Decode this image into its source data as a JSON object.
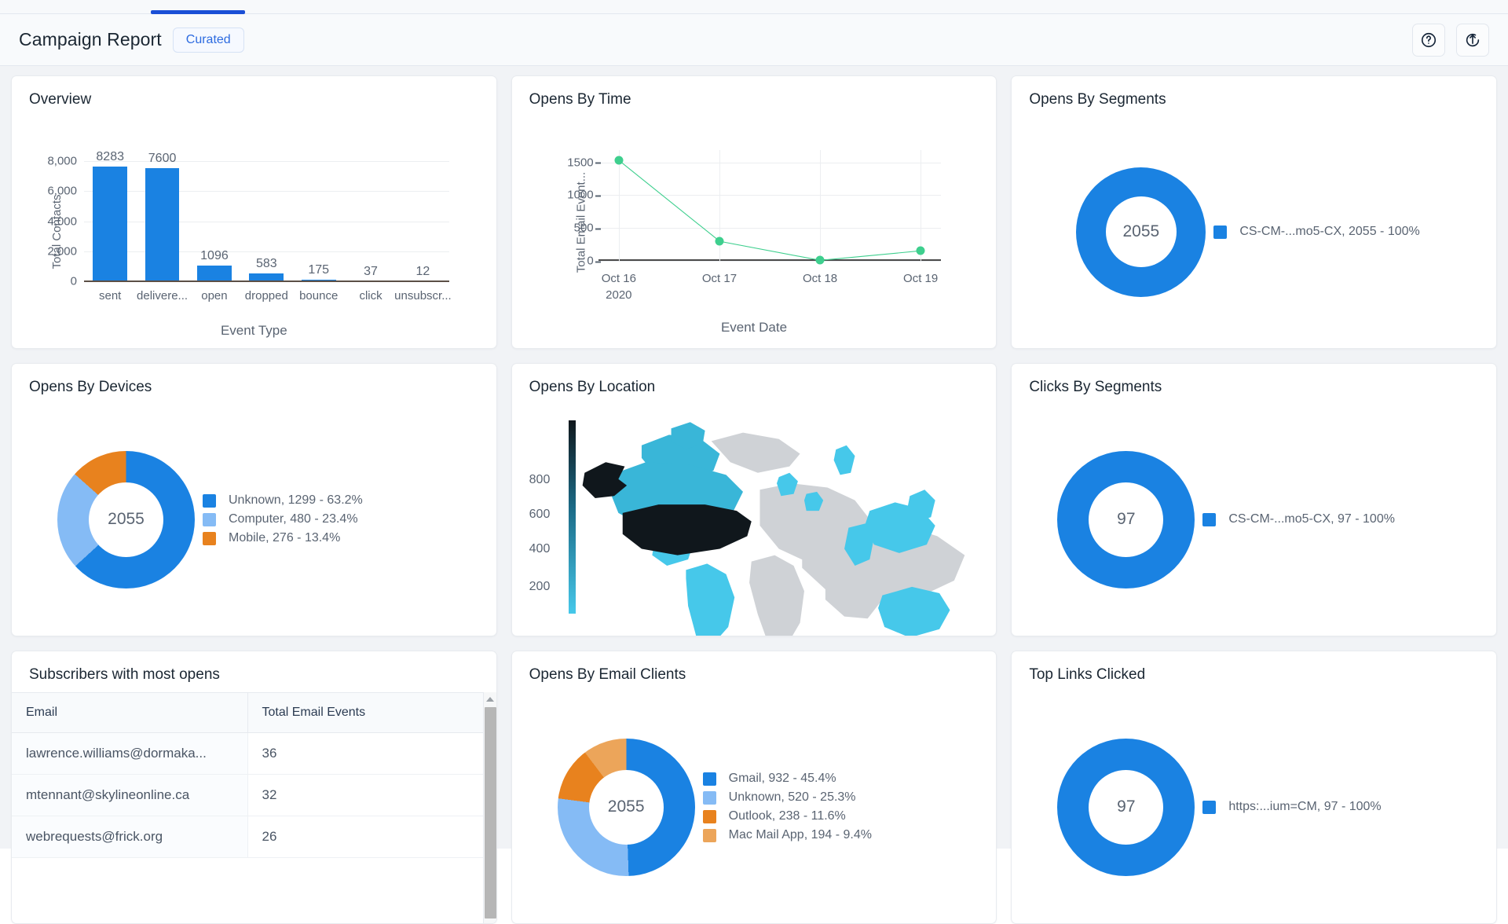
{
  "header": {
    "title": "Campaign Report",
    "badge": "Curated",
    "help_icon": "help-circle-icon",
    "export_icon": "export-up-icon"
  },
  "cards": {
    "overview": {
      "title": "Overview"
    },
    "opens_by_time": {
      "title": "Opens By Time"
    },
    "opens_by_segments": {
      "title": "Opens By Segments"
    },
    "opens_by_devices": {
      "title": "Opens By Devices"
    },
    "opens_by_location": {
      "title": "Opens By Location"
    },
    "clicks_by_segments": {
      "title": "Clicks By Segments"
    },
    "subscribers": {
      "title": "Subscribers with most opens"
    },
    "opens_by_email_clients": {
      "title": "Opens By Email Clients"
    },
    "top_links": {
      "title": "Top Links Clicked"
    }
  },
  "table": {
    "columns": [
      "Email",
      "Total Email Events"
    ],
    "rows": [
      [
        "lawrence.williams@dormaka...",
        "36"
      ],
      [
        "mtennant@skylineonline.ca",
        "32"
      ],
      [
        "webrequests@frick.org",
        "26"
      ]
    ]
  },
  "colors": {
    "blue": "#1a82e2",
    "light_blue": "#85bbf5",
    "orange": "#e8821e",
    "light_orange": "#eca55a",
    "green": "#3ecf8e",
    "map_dark": "#10171c",
    "map_mid": "#39b6d8",
    "map_light": "#46c8ea",
    "map_none": "#cfd2d6",
    "accent": "#1a4fd6"
  },
  "chart_data": [
    {
      "type": "bar",
      "title": "Overview",
      "xlabel": "Event Type",
      "ylabel": "Total Contacts",
      "categories": [
        "sent",
        "delivere...",
        "open",
        "dropped",
        "bounce",
        "click",
        "unsubscr..."
      ],
      "values": [
        8283,
        7600,
        1096,
        583,
        175,
        37,
        12
      ],
      "yticks": [
        0,
        2000,
        4000,
        6000,
        8000
      ],
      "ytick_labels": [
        "0",
        "2,000",
        "4,000",
        "6,000",
        "8,000"
      ],
      "ylim": [
        0,
        8800
      ],
      "grid": true,
      "legend": "none"
    },
    {
      "type": "line",
      "title": "Opens By Time",
      "xlabel": "Event Date",
      "ylabel": "Total Email Event...",
      "x": [
        "Oct 16\n2020",
        "Oct 17",
        "Oct 18",
        "Oct 19"
      ],
      "xtick_labels": [
        [
          "Oct 16",
          "2020"
        ],
        [
          "Oct 17",
          ""
        ],
        [
          "Oct 18",
          ""
        ],
        [
          "Oct 19",
          ""
        ]
      ],
      "values": [
        1540,
        310,
        20,
        165
      ],
      "yticks": [
        0,
        500,
        1000,
        1500
      ],
      "ytick_labels": [
        "0",
        "500",
        "1000",
        "1500"
      ],
      "ylim": [
        0,
        1700
      ],
      "grid": true,
      "series_color": "#3ecf8e"
    },
    {
      "type": "pie",
      "title": "Opens By Segments",
      "center_label": "2055",
      "legend_position": "right",
      "slices": [
        {
          "name": "CS-CM-...mo5-CX",
          "value": 2055,
          "percent": "100%",
          "color": "#1a82e2",
          "legend": "CS-CM-...mo5-CX,  2055 - 100%"
        }
      ]
    },
    {
      "type": "pie",
      "title": "Opens By Devices",
      "center_label": "2055",
      "legend_position": "right",
      "slices": [
        {
          "name": "Unknown",
          "value": 1299,
          "percent": "63.2%",
          "color": "#1a82e2",
          "legend": "Unknown,  1299 - 63.2%"
        },
        {
          "name": "Computer",
          "value": 480,
          "percent": "23.4%",
          "color": "#85bbf5",
          "legend": "Computer,  480 - 23.4%"
        },
        {
          "name": "Mobile",
          "value": 276,
          "percent": "13.4%",
          "color": "#e8821e",
          "legend": "Mobile,  276 - 13.4%"
        }
      ]
    },
    {
      "type": "heatmap",
      "title": "Opens By Location",
      "subtype": "choropleth-world-map",
      "scale_ticks": [
        "800",
        "600",
        "400",
        "200"
      ],
      "scale_range": [
        0,
        900
      ]
    },
    {
      "type": "pie",
      "title": "Clicks By Segments",
      "center_label": "97",
      "legend_position": "right",
      "slices": [
        {
          "name": "CS-CM-...mo5-CX",
          "value": 97,
          "percent": "100%",
          "color": "#1a82e2",
          "legend": "CS-CM-...mo5-CX,  97 - 100%"
        }
      ]
    },
    {
      "type": "pie",
      "title": "Opens By Email Clients",
      "center_label": "2055",
      "legend_position": "right",
      "slices": [
        {
          "name": "Gmail",
          "value": 932,
          "percent": "45.4%",
          "color": "#1a82e2",
          "legend": "Gmail,  932 - 45.4%"
        },
        {
          "name": "Unknown",
          "value": 520,
          "percent": "25.3%",
          "color": "#85bbf5",
          "legend": "Unknown,  520 - 25.3%"
        },
        {
          "name": "Outlook",
          "value": 238,
          "percent": "11.6%",
          "color": "#e8821e",
          "legend": "Outlook,  238 - 11.6%"
        },
        {
          "name": "Mac Mail App",
          "value": 194,
          "percent": "9.4%",
          "color": "#eca55a",
          "legend": "Mac Mail App,  194 - 9.4%"
        }
      ]
    },
    {
      "type": "pie",
      "title": "Top Links Clicked",
      "center_label": "97",
      "legend_position": "right",
      "slices": [
        {
          "name": "https:...ium=CM",
          "value": 97,
          "percent": "100%",
          "color": "#1a82e2",
          "legend": "https:...ium=CM,  97 - 100%"
        }
      ]
    }
  ]
}
